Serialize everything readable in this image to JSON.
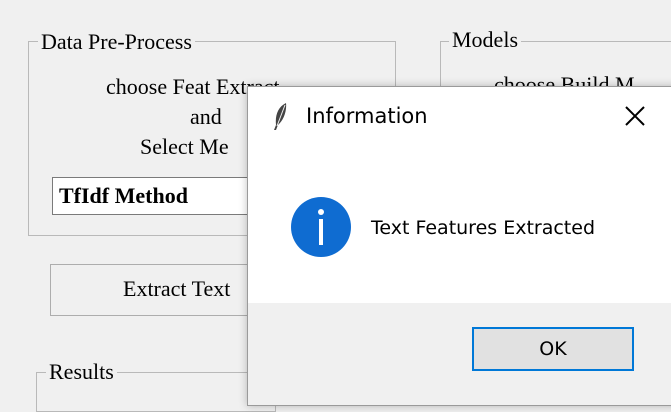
{
  "preprocess": {
    "legend": "Data Pre-Process",
    "line1": "choose Feat Extract",
    "line2": "and",
    "line3": "Select Me",
    "combo_value": "TfIdf Method",
    "extract_button": "Extract Text"
  },
  "models": {
    "legend": "Models",
    "line1": "choose Build M"
  },
  "results": {
    "legend": "Results"
  },
  "dialog": {
    "title": "Information",
    "message": "Text Features Extracted",
    "ok_label": "OK",
    "icons": {
      "title": "feather-icon",
      "close": "close-icon",
      "body": "info-icon"
    },
    "accent_color": "#0078d7"
  }
}
